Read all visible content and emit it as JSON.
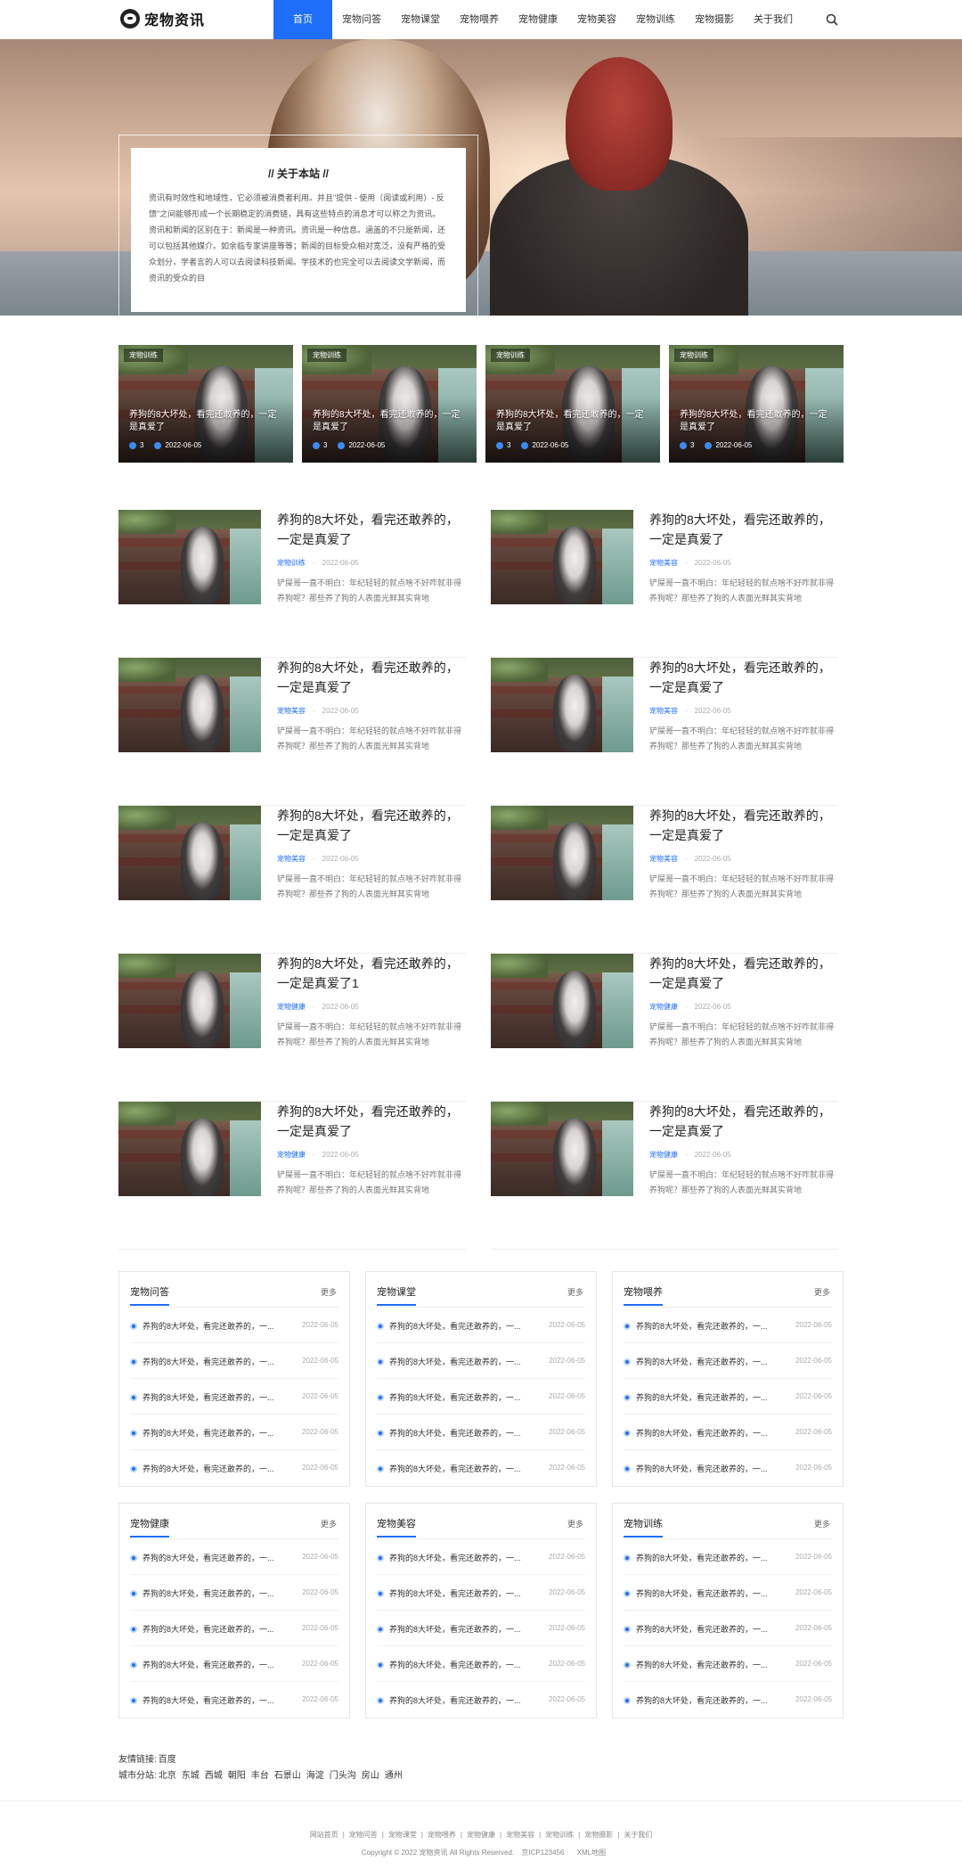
{
  "site": {
    "logo_text": "宠物资讯"
  },
  "nav": [
    "首页",
    "宠物问答",
    "宠物课堂",
    "宠物喂养",
    "宠物健康",
    "宠物美容",
    "宠物训练",
    "宠物摄影",
    "关于我们"
  ],
  "about": {
    "title": "// 关于本站 //",
    "text": "资讯有时效性和地域性，它必须被消费者利用。并且\"提供 - 使用（阅读或利用）- 反馈\"之间能够形成一个长期稳定的消费链，具有这些特点的消息才可以称之为资讯。资讯和新闻的区别在于：新闻是一种资讯。资讯是一种信息。涵盖的不只是新闻，还可以包括其他媒介。如余临专家讲座等等；新闻的目标受众相对宽泛，没有严格的受众划分，学者言的人可以去阅读科技新闻。学技术的也完全可以去阅读文学新闻，而资讯的受众的目"
  },
  "featured": [
    {
      "tag": "宠物训练",
      "title": "养狗的8大坏处，看完还敢养的，一定是真爱了",
      "views": "3",
      "date": "2022-06-05"
    },
    {
      "tag": "宠物训练",
      "title": "养狗的8大坏处，看完还敢养的，一定是真爱了",
      "views": "3",
      "date": "2022-06-05"
    },
    {
      "tag": "宠物训练",
      "title": "养狗的8大坏处，看完还敢养的，一定是真爱了",
      "views": "3",
      "date": "2022-06-05"
    },
    {
      "tag": "宠物训练",
      "title": "养狗的8大坏处，看完还敢养的，一定是真爱了",
      "views": "3",
      "date": "2022-06-05"
    }
  ],
  "articles": [
    {
      "title": "养狗的8大坏处，看完还敢养的，一定是真爱了",
      "cat": "宠物训练",
      "date": "2022-06-05",
      "desc": "铲屎哥一直不明白：年纪轻轻的就点啥不好咋就非得养狗呢？那些养了狗的人表面光鲜其实背地"
    },
    {
      "title": "养狗的8大坏处，看完还敢养的，一定是真爱了",
      "cat": "宠物美容",
      "date": "2022-06-05",
      "desc": "铲屎哥一直不明白：年纪轻轻的就点啥不好咋就非得养狗呢？那些养了狗的人表面光鲜其实背地"
    },
    {
      "title": "养狗的8大坏处，看完还敢养的，一定是真爱了",
      "cat": "宠物美容",
      "date": "2022-06-05",
      "desc": "铲屎哥一直不明白：年纪轻轻的就点啥不好咋就非得养狗呢？那些养了狗的人表面光鲜其实背地"
    },
    {
      "title": "养狗的8大坏处，看完还敢养的，一定是真爱了",
      "cat": "宠物美容",
      "date": "2022-06-05",
      "desc": "铲屎哥一直不明白：年纪轻轻的就点啥不好咋就非得养狗呢？那些养了狗的人表面光鲜其实背地"
    },
    {
      "title": "养狗的8大坏处，看完还敢养的，一定是真爱了",
      "cat": "宠物美容",
      "date": "2022-06-05",
      "desc": "铲屎哥一直不明白：年纪轻轻的就点啥不好咋就非得养狗呢？那些养了狗的人表面光鲜其实背地"
    },
    {
      "title": "养狗的8大坏处，看完还敢养的，一定是真爱了",
      "cat": "宠物美容",
      "date": "2022-06-05",
      "desc": "铲屎哥一直不明白：年纪轻轻的就点啥不好咋就非得养狗呢？那些养了狗的人表面光鲜其实背地"
    },
    {
      "title": "养狗的8大坏处，看完还敢养的，一定是真爱了1",
      "cat": "宠物健康",
      "date": "2022-06-05",
      "desc": "铲屎哥一直不明白：年纪轻轻的就点啥不好咋就非得养狗呢？那些养了狗的人表面光鲜其实背地"
    },
    {
      "title": "养狗的8大坏处，看完还敢养的，一定是真爱了",
      "cat": "宠物健康",
      "date": "2022-06-05",
      "desc": "铲屎哥一直不明白：年纪轻轻的就点啥不好咋就非得养狗呢？那些养了狗的人表面光鲜其实背地"
    },
    {
      "title": "养狗的8大坏处，看完还敢养的，一定是真爱了",
      "cat": "宠物健康",
      "date": "2022-06-05",
      "desc": "铲屎哥一直不明白：年纪轻轻的就点啥不好咋就非得养狗呢？那些养了狗的人表面光鲜其实背地"
    },
    {
      "title": "养狗的8大坏处，看完还敢养的，一定是真爱了",
      "cat": "宠物健康",
      "date": "2022-06-05",
      "desc": "铲屎哥一直不明白：年纪轻轻的就点啥不好咋就非得养狗呢？那些养了狗的人表面光鲜其实背地"
    }
  ],
  "panels": [
    {
      "title": "宠物问答",
      "more": "更多",
      "items": [
        {
          "t": "养狗的8大坏处，看完还敢养的，一...",
          "d": "2022-06-05"
        },
        {
          "t": "养狗的8大坏处，看完还敢养的，一...",
          "d": "2022-06-05"
        },
        {
          "t": "养狗的8大坏处，看完还敢养的，一...",
          "d": "2022-06-05"
        },
        {
          "t": "养狗的8大坏处，看完还敢养的，一...",
          "d": "2022-06-05"
        },
        {
          "t": "养狗的8大坏处，看完还敢养的，一...",
          "d": "2022-06-05"
        }
      ]
    },
    {
      "title": "宠物课堂",
      "more": "更多",
      "items": [
        {
          "t": "养狗的8大坏处，看完还敢养的，一...",
          "d": "2022-06-05"
        },
        {
          "t": "养狗的8大坏处，看完还敢养的，一...",
          "d": "2022-06-05"
        },
        {
          "t": "养狗的8大坏处，看完还敢养的，一...",
          "d": "2022-06-05"
        },
        {
          "t": "养狗的8大坏处，看完还敢养的，一...",
          "d": "2022-06-05"
        },
        {
          "t": "养狗的8大坏处，看完还敢养的，一...",
          "d": "2022-06-05"
        }
      ]
    },
    {
      "title": "宠物喂养",
      "more": "更多",
      "items": [
        {
          "t": "养狗的8大坏处，看完还敢养的，一...",
          "d": "2022-06-05"
        },
        {
          "t": "养狗的8大坏处，看完还敢养的，一...",
          "d": "2022-06-05"
        },
        {
          "t": "养狗的8大坏处，看完还敢养的，一...",
          "d": "2022-06-05"
        },
        {
          "t": "养狗的8大坏处，看完还敢养的，一...",
          "d": "2022-06-05"
        },
        {
          "t": "养狗的8大坏处，看完还敢养的，一...",
          "d": "2022-06-05"
        }
      ]
    },
    {
      "title": "宠物健康",
      "more": "更多",
      "items": [
        {
          "t": "养狗的8大坏处，看完还敢养的，一...",
          "d": "2022-06-05"
        },
        {
          "t": "养狗的8大坏处，看完还敢养的，一...",
          "d": "2022-06-05"
        },
        {
          "t": "养狗的8大坏处，看完还敢养的，一...",
          "d": "2022-06-05"
        },
        {
          "t": "养狗的8大坏处，看完还敢养的，一...",
          "d": "2022-06-05"
        },
        {
          "t": "养狗的8大坏处，看完还敢养的，一...",
          "d": "2022-06-05"
        }
      ]
    },
    {
      "title": "宠物美容",
      "more": "更多",
      "items": [
        {
          "t": "养狗的8大坏处，看完还敢养的，一...",
          "d": "2022-06-05"
        },
        {
          "t": "养狗的8大坏处，看完还敢养的，一...",
          "d": "2022-06-05"
        },
        {
          "t": "养狗的8大坏处，看完还敢养的，一...",
          "d": "2022-06-05"
        },
        {
          "t": "养狗的8大坏处，看完还敢养的，一...",
          "d": "2022-06-05"
        },
        {
          "t": "养狗的8大坏处，看完还敢养的，一...",
          "d": "2022-06-05"
        }
      ]
    },
    {
      "title": "宠物训练",
      "more": "更多",
      "items": [
        {
          "t": "养狗的8大坏处，看完还敢养的，一...",
          "d": "2022-06-05"
        },
        {
          "t": "养狗的8大坏处，看完还敢养的，一...",
          "d": "2022-06-05"
        },
        {
          "t": "养狗的8大坏处，看完还敢养的，一...",
          "d": "2022-06-05"
        },
        {
          "t": "养狗的8大坏处，看完还敢养的，一...",
          "d": "2022-06-05"
        },
        {
          "t": "养狗的8大坏处，看完还敢养的，一...",
          "d": "2022-06-05"
        }
      ]
    }
  ],
  "links": {
    "friend_label": "友情链接:",
    "friend": [
      "百度"
    ],
    "city_label": "城市分站:",
    "cities": [
      "北京",
      "东城",
      "西城",
      "朝阳",
      "丰台",
      "石景山",
      "海淀",
      "门头沟",
      "房山",
      "通州"
    ]
  },
  "footer": {
    "nav": [
      "网站首页",
      "宠物问答",
      "宠物课堂",
      "宠物喂养",
      "宠物健康",
      "宠物美容",
      "宠物训练",
      "宠物摄影",
      "关于我们"
    ],
    "copyright": "Copyright © 2022 宠物资讯 All Rights Reserved.",
    "icp": "京ICP123456",
    "xml": "XML地图"
  },
  "colors": {
    "accent": "#1e6ef9"
  }
}
